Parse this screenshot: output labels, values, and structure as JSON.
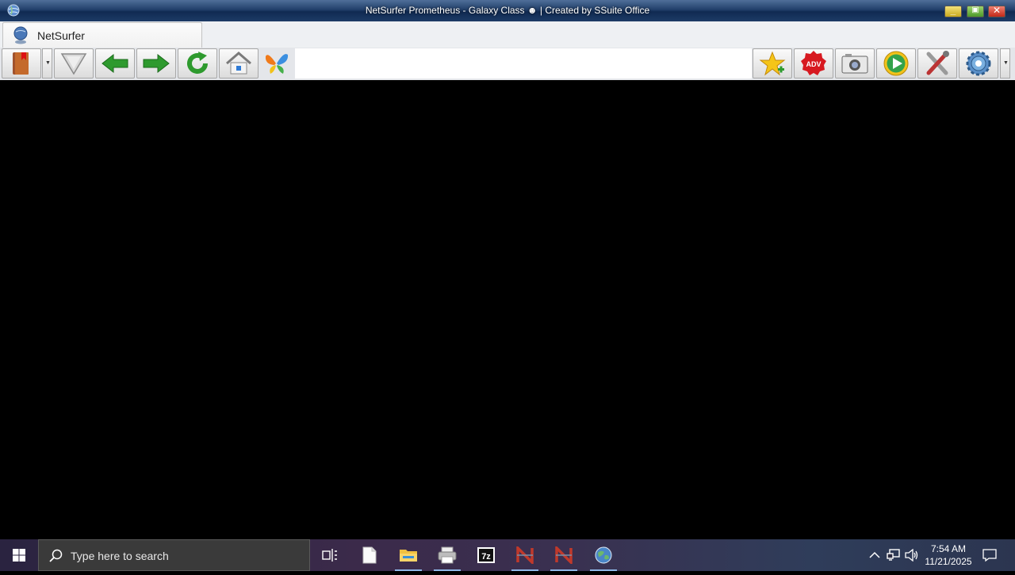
{
  "window": {
    "title": "NetSurfer Prometheus - Galaxy Class ",
    "title_suffix": "|   Created by SSuite Office",
    "mask_icon": "alien-mask-icon"
  },
  "tabs": [
    {
      "label": "NetSurfer",
      "icon": "globe-user-icon"
    }
  ],
  "toolbar": {
    "buttons": [
      "bookmarks-book-icon",
      "menu-dropdown-icon",
      "filter-funnel-icon",
      "back-arrow-icon",
      "forward-arrow-icon",
      "refresh-icon",
      "home-icon",
      "butterfly-icon",
      "add-favorite-star-icon",
      "ad-block-icon",
      "screenshot-camera-icon",
      "media-play-icon",
      "tools-icon",
      "settings-gear-icon"
    ],
    "address": {
      "value": "",
      "placeholder": ""
    }
  },
  "taskbar": {
    "search_placeholder": "Type here to search",
    "apps": [
      "task-view-icon",
      "notepad-icon",
      "file-explorer-icon",
      "printer-icon",
      "7zip-icon",
      "netsurfer-app-icon",
      "netsurfer-app-icon-2",
      "globe-browser-icon"
    ],
    "time": "7:54 AM",
    "date": "11/21/2025"
  },
  "colors": {
    "titlebar": "#1d3b66",
    "content_bg": "#000000",
    "green_arrow": "#2e9a2e"
  }
}
